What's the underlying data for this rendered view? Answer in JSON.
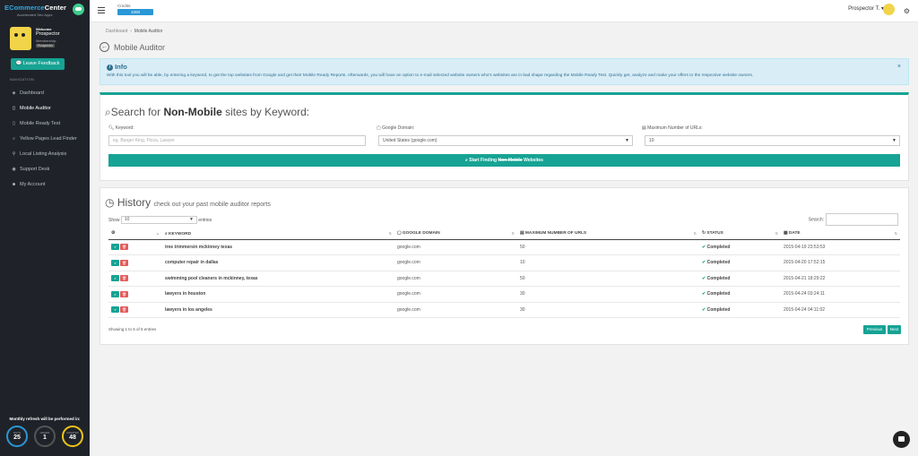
{
  "brand": {
    "name_prefix": "E",
    "name_main": "Commerce",
    "name_suffix": "Center",
    "tagline": "Accelerated Seo Apps"
  },
  "user": {
    "welcome": "Welcome",
    "name": "Prospector",
    "membership_label": "Membership:",
    "membership_badge": "Prospector"
  },
  "feedback_button": "Leave Feedback",
  "nav_header": "NAVIGATION",
  "nav": [
    {
      "label": "Dashboard",
      "icon": "dashboard-icon",
      "glyph": "◈"
    },
    {
      "label": "Mobile Auditor",
      "icon": "mobile-icon",
      "glyph": "▯"
    },
    {
      "label": "Mobile Ready Test",
      "icon": "mobile-icon",
      "glyph": "▯"
    },
    {
      "label": "Yellow Pages Lead Finder",
      "icon": "search-icon",
      "glyph": "⌕"
    },
    {
      "label": "Local Listing Analysis",
      "icon": "map-marker-icon",
      "glyph": "⚲"
    },
    {
      "label": "Support Desk",
      "icon": "support-icon",
      "glyph": "◉"
    },
    {
      "label": "My Account",
      "icon": "user-icon",
      "glyph": "☻"
    }
  ],
  "refresh": {
    "title": "Monthly refresh will be performed in:",
    "dials": [
      {
        "unit": "DAYS",
        "value": "25",
        "color": "#2a97d6"
      },
      {
        "unit": "HOURS",
        "value": "1",
        "color": "#1f2329"
      },
      {
        "unit": "MINUTES",
        "value": "48",
        "color": "#f0c419"
      }
    ]
  },
  "topbar": {
    "credits_label": "Credits:",
    "credits_value": "1000",
    "user_label": "Prospector T.",
    "user_caret": "▾"
  },
  "breadcrumb": {
    "home": "Dashboard",
    "sep": "›",
    "current": "Mobile Auditor"
  },
  "page_title": "Mobile Auditor",
  "info": {
    "title": "Info",
    "body": "With this tool you will be able, by entering a keyword, to get the top websites from Google and get their Mobile Ready Reports. Afterwards, you will have an option to e-mail selected website owners who's websites are in bad shape regarding the Mobile Ready Test. Quickly get, analyze and make your offers to the respective website owners.",
    "close": "×"
  },
  "search": {
    "title_pre": "Search for ",
    "title_bold": "Non-Mobile",
    "title_post": " sites by Keyword:",
    "keyword_label": "Keyword:",
    "keyword_placeholder": "eg. Burger King, Pizza, Lawyer",
    "domain_label": "Google Domain:",
    "domain_value": "United States (google.com)",
    "max_label": "Maximum Number of URLs:",
    "max_value": "10",
    "button_pre": "Start Finding ",
    "button_strike": "Non-Mobile",
    "button_post": " Websites"
  },
  "history": {
    "title": "History",
    "subtitle": "check out your past mobile auditor reports",
    "show_label": "Show",
    "show_value": "10",
    "entries_label": "entries",
    "search_label": "Search:",
    "columns": [
      "KEYWORD",
      "GOOGLE DOMAIN",
      "MAXIMUM NUMBER OF URLS",
      "STATUS",
      "DATE"
    ],
    "rows": [
      {
        "keyword": "tree trimmersin mckinney texas",
        "domain": "google.com",
        "max": "50",
        "status": "Completed",
        "date": "2015-04-19 23:53:53"
      },
      {
        "keyword": "computer repair in dallas",
        "domain": "google.com",
        "max": "10",
        "status": "Completed",
        "date": "2015-04-20 17:52:15"
      },
      {
        "keyword": "swimming pool cleaners in mckinney, texas",
        "domain": "google.com",
        "max": "50",
        "status": "Completed",
        "date": "2015-04-21 18:29:22"
      },
      {
        "keyword": "lawyers in houston",
        "domain": "google.com",
        "max": "30",
        "status": "Completed",
        "date": "2015-04-24 03:24:11"
      },
      {
        "keyword": "lawyers in los angeles",
        "domain": "google.com",
        "max": "30",
        "status": "Completed",
        "date": "2015-04-24 04:11:02"
      }
    ],
    "showing": "Showing 1 to 5 of 5 entries",
    "prev": "Previous",
    "next": "Next"
  },
  "colors": {
    "accent": "#16a394",
    "sidebar": "#1f2329",
    "info_bg": "#d9edf7",
    "danger": "#e35b5a",
    "credits": "#2a97d6"
  }
}
